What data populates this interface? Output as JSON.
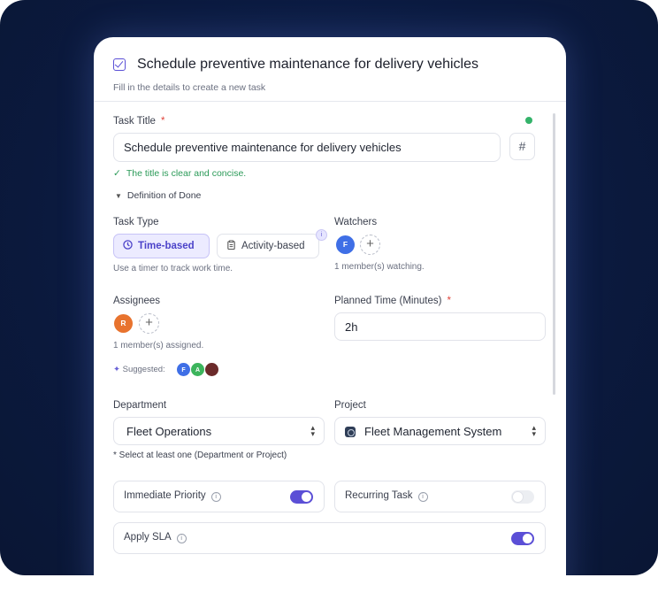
{
  "header": {
    "title": "Schedule preventive maintenance for delivery vehicles",
    "subtitle": "Fill in the details to create a new task"
  },
  "task_title": {
    "label": "Task Title",
    "required_mark": "*",
    "value": "Schedule preventive maintenance for delivery vehicles",
    "hash_button": "#",
    "validation": "The title is clear and concise.",
    "definition_of_done": "Definition of Done"
  },
  "task_type": {
    "label": "Task Type",
    "options": [
      "Time-based",
      "Activity-based"
    ],
    "selected": "Time-based",
    "hint": "Use a timer to track work time."
  },
  "watchers": {
    "label": "Watchers",
    "avatars": [
      {
        "initial": "F",
        "color": "#3f6fe6"
      }
    ],
    "count_text": "1 member(s) watching."
  },
  "assignees": {
    "label": "Assignees",
    "avatars": [
      {
        "initial": "R",
        "color": "#e8732e"
      }
    ],
    "count_text": "1 member(s) assigned.",
    "suggested_label": "Suggested:",
    "suggested": [
      {
        "initial": "F",
        "color": "#3f6fe6"
      },
      {
        "initial": "A",
        "color": "#3cb45c"
      },
      {
        "initial": "",
        "color": "#6b2a2a"
      }
    ]
  },
  "planned_time": {
    "label": "Planned Time (Minutes)",
    "required_mark": "*",
    "value": "2h"
  },
  "department": {
    "label": "Department",
    "value": "Fleet Operations"
  },
  "project": {
    "label": "Project",
    "value": "Fleet Management System"
  },
  "selection_note": "* Select at least one (Department or Project)",
  "toggles": {
    "immediate_priority": {
      "label": "Immediate Priority",
      "on": true
    },
    "recurring_task": {
      "label": "Recurring Task",
      "on": false
    },
    "apply_sla": {
      "label": "Apply SLA",
      "on": true
    }
  },
  "colors": {
    "accent": "#5b4fd6",
    "success": "#2b9a58",
    "required": "#e0453b",
    "background": "#0b1a3f"
  }
}
